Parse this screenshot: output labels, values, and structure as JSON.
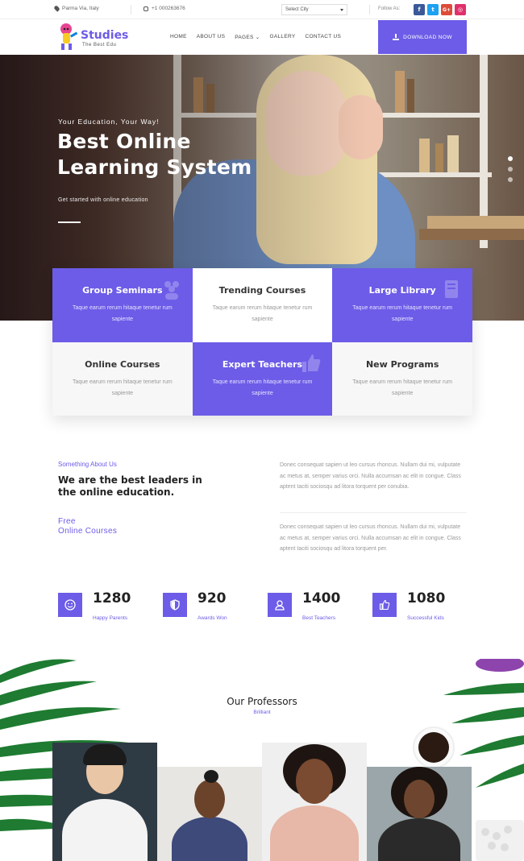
{
  "topbar": {
    "location": "Parma Via, Italy",
    "phone": "+1 000263676",
    "select_city": "Select City",
    "follow_label": "Follow As:",
    "social": [
      {
        "icon": "facebook-icon",
        "glyph": "f",
        "color": "#3b5998"
      },
      {
        "icon": "twitter-icon",
        "glyph": "t",
        "color": "#1da1f2"
      },
      {
        "icon": "google-plus-icon",
        "glyph": "G+",
        "color": "#dd4b39"
      },
      {
        "icon": "instagram-icon",
        "glyph": "◎",
        "color": "#e1306c"
      }
    ]
  },
  "header": {
    "logo_title": "Studies",
    "logo_subtitle": "The Best Edu",
    "nav": [
      "HOME",
      "ABOUT US",
      "PAGES ⌄",
      "GALLERY",
      "CONTACT US"
    ],
    "download_label": "DOWNLOAD NOW"
  },
  "hero": {
    "kicker": "Your Education, Your Way!",
    "title_line1": "Best Online",
    "title_line2": "Learning System",
    "subtitle": "Get started with online education"
  },
  "features": [
    {
      "title": "Group Seminars",
      "desc": "Taque earum rerum hitaque tenetur rum sapiente",
      "style": "purple",
      "icon": "group-icon"
    },
    {
      "title": "Trending Courses",
      "desc": "Taque earum rerum hitaque tenetur rum sapiente",
      "style": "white",
      "icon": ""
    },
    {
      "title": "Large Library",
      "desc": "Taque earum rerum hitaque tenetur rum sapiente",
      "style": "purple",
      "icon": "book-icon"
    },
    {
      "title": "Online Courses",
      "desc": "Taque earum rerum hitaque tenetur rum sapiente",
      "style": "light",
      "icon": ""
    },
    {
      "title": "Expert Teachers",
      "desc": "Taque earum rerum hitaque tenetur rum sapiente",
      "style": "purple",
      "icon": "thumbs-up-icon"
    },
    {
      "title": "New Programs",
      "desc": "Taque earum rerum hitaque tenetur rum sapiente",
      "style": "light",
      "icon": ""
    }
  ],
  "about": {
    "kicker": "Something About Us",
    "title": "We are the best leaders in the online education.",
    "free_line1": "Free",
    "free_line2": "Online Courses",
    "para1": "Donec consequat sapien ut leo cursus rhoncus. Nullam dui mi, vulputate ac metus at, semper varius orci. Nulla accumsan ac elit in congue. Class aptent taciti sociosqu ad litora torquent per conubia.",
    "para2": "Donec consequat sapien ut leo cursus rhoncus. Nullam dui mi, vulputate ac metus at, semper varius orci. Nulla accumsan ac elit in congue. Class aptent taciti sociosqu ad litora torquent per."
  },
  "stats": [
    {
      "number": "1280",
      "label": "Happy Parents",
      "icon": "smile-icon"
    },
    {
      "number": "920",
      "label": "Awards Won",
      "icon": "shield-icon"
    },
    {
      "number": "1400",
      "label": "Best Teachers",
      "icon": "user-icon"
    },
    {
      "number": "1080",
      "label": "Successful Kids",
      "icon": "thumbs-up-icon"
    }
  ],
  "professors": {
    "title": "Our Professors",
    "subtitle": "Brilliant"
  },
  "colors": {
    "accent": "#6c5ce7"
  }
}
